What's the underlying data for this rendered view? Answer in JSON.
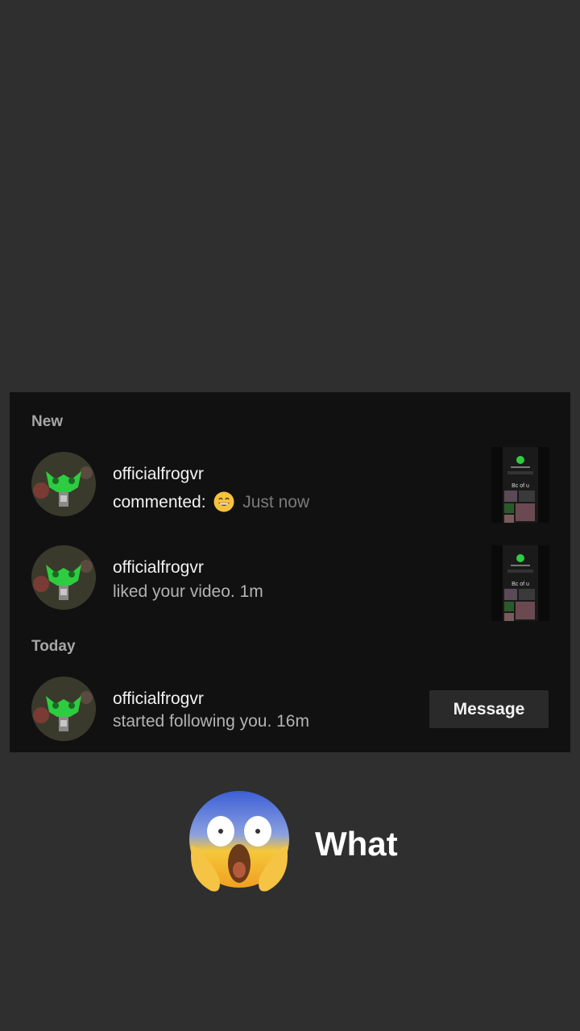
{
  "sections": {
    "new_label": "New",
    "today_label": "Today"
  },
  "notifications": [
    {
      "username": "officialfrogvr",
      "action": "commented:",
      "emoji": "grinning-face-emoji",
      "time": "Just now"
    },
    {
      "username": "officialfrogvr",
      "action": "liked your video.",
      "time": "1m"
    },
    {
      "username": "officialfrogvr",
      "action": "started following you.",
      "time": "16m",
      "button_label": "Message"
    }
  ],
  "thumbnail_text": "Bc of u",
  "caption": {
    "emoji": "face-screaming-in-fear-emoji",
    "text": "What"
  },
  "colors": {
    "background": "#2f2f2f",
    "panel": "#111111",
    "avatar_accent": "#2ecc40"
  }
}
